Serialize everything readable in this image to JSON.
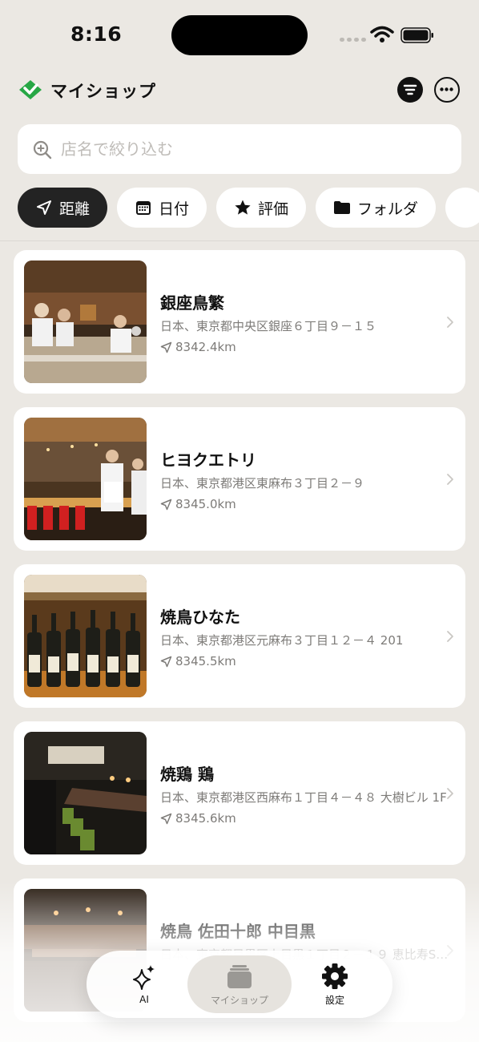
{
  "status": {
    "time": "8:16"
  },
  "header": {
    "title": "マイショップ",
    "logo_icon": "green-diamond-check-icon",
    "filter_icon": "filter-lines-icon",
    "more_icon": "ellipsis-circle-icon"
  },
  "search": {
    "placeholder": "店名で絞り込む",
    "value": "",
    "icon": "zoom-in-icon"
  },
  "chips": [
    {
      "label": "距離",
      "icon": "location-arrow-icon",
      "active": true
    },
    {
      "label": "日付",
      "icon": "calendar-icon",
      "active": false
    },
    {
      "label": "評価",
      "icon": "star-icon",
      "active": false
    },
    {
      "label": "フォルダ",
      "icon": "folder-icon",
      "active": false
    }
  ],
  "shops": [
    {
      "name": "銀座鳥繁",
      "address": "日本、東京都中央区銀座６丁目９－１５",
      "distance": "8342.4km"
    },
    {
      "name": "ヒヨクエトリ",
      "address": "日本、東京都港区東麻布３丁目２－９",
      "distance": "8345.0km"
    },
    {
      "name": "焼鳥ひなた",
      "address": "日本、東京都港区元麻布３丁目１２－４ 201",
      "distance": "8345.5km"
    },
    {
      "name": "焼鶏 鶏",
      "address": "日本、東京都港区西麻布１丁目４－４８ 大樹ビル 1F",
      "distance": "8345.6km"
    },
    {
      "name": "焼鳥 佐田十郎 中目黒",
      "address": "日本、東京都目黒区上目黒１丁目２－１９ 恵比寿S…",
      "distance": ""
    }
  ],
  "tabbar": {
    "ai": {
      "label": "AI",
      "icon": "sparkles-icon"
    },
    "shop": {
      "label": "マイショップ",
      "icon": "stack-cards-icon",
      "selected": true
    },
    "settings": {
      "label": "設定",
      "icon": "gear-icon"
    }
  },
  "colors": {
    "background": "#ebe8e3",
    "accent_green": "#27a745",
    "active_chip": "#232323"
  }
}
